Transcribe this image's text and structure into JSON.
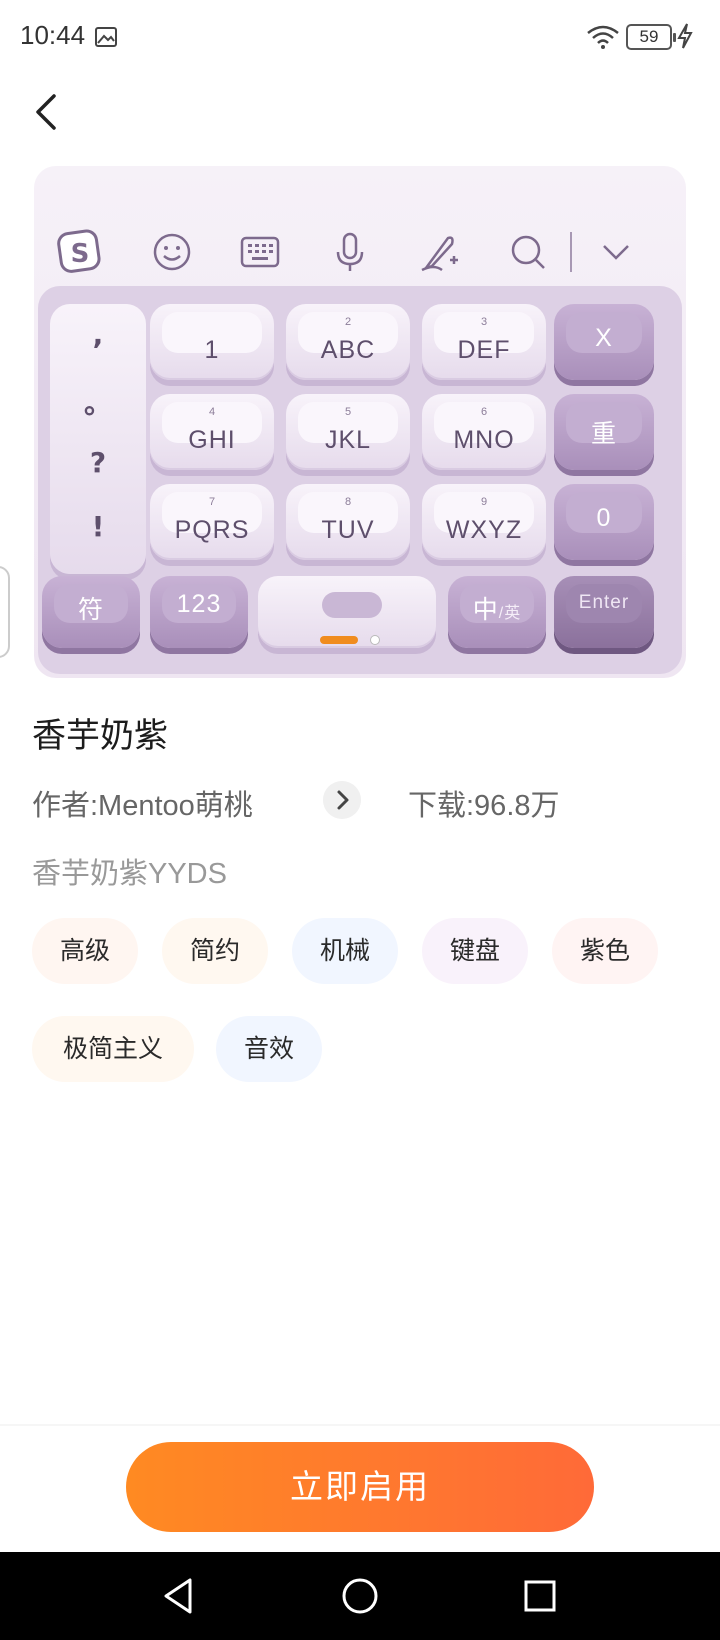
{
  "status_bar": {
    "time": "10:44",
    "battery": "59",
    "icons": [
      "image-icon",
      "wifi-icon",
      "battery-icon",
      "charging-icon"
    ]
  },
  "preview": {
    "toolbar_icons": [
      "sogou-logo-icon",
      "emoji-icon",
      "keyboard-icon",
      "microphone-icon",
      "handwriting-icon",
      "search-icon",
      "chevron-down-icon"
    ],
    "punctuation": [
      ",",
      "。",
      "?",
      "!"
    ],
    "keys": {
      "k1": {
        "main": "1",
        "sub": ""
      },
      "k2": {
        "main": "ABC",
        "sub": "2"
      },
      "k3": {
        "main": "DEF",
        "sub": "3"
      },
      "k4": {
        "main": "GHI",
        "sub": "4"
      },
      "k5": {
        "main": "JKL",
        "sub": "5"
      },
      "k6": {
        "main": "MNO",
        "sub": "6"
      },
      "k7": {
        "main": "PQRS",
        "sub": "7"
      },
      "k8": {
        "main": "TUV",
        "sub": "8"
      },
      "k9": {
        "main": "WXYZ",
        "sub": "9"
      },
      "delete": "X",
      "retype": "重",
      "zero": "0",
      "symbol": "符",
      "num": "123",
      "lang_main": "中",
      "lang_sub": "/英",
      "enter": "Enter"
    }
  },
  "theme": {
    "title": "香芋奶紫",
    "author": "作者:Mentoo萌桃",
    "downloads": "下载:96.8万",
    "description": "香芋奶紫YYDS"
  },
  "tags": [
    {
      "label": "高级",
      "color": "#fff6f1"
    },
    {
      "label": "简约",
      "color": "#fff8f0"
    },
    {
      "label": "机械",
      "color": "#f1f6ff"
    },
    {
      "label": "键盘",
      "color": "#f9f2fb"
    },
    {
      "label": "紫色",
      "color": "#fff4f3"
    },
    {
      "label": "极简主义",
      "color": "#fff8f0"
    },
    {
      "label": "音效",
      "color": "#f1f6ff"
    }
  ],
  "apply_button": "立即启用",
  "nav": [
    "back-nav-icon",
    "home-nav-icon",
    "recents-nav-icon"
  ]
}
